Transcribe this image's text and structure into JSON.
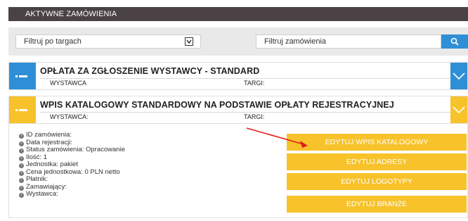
{
  "page_title": "AKTYWNE ZAMÓWIENIA",
  "filters": {
    "select_value": "Filtruj po targach",
    "search_placeholder": "Filtruj zamówienia"
  },
  "orders": [
    {
      "title": "OPŁATA ZA ZGŁOSZENIE WYSTAWCY - STANDARD",
      "exhibitor_label": "WYSTAWCA",
      "fair_label": "TARGI:",
      "color": "#2e8fd6",
      "expanded": false
    },
    {
      "title": "WPIS KATALOGOWY STANDARDOWY NA PODSTAWIE OPŁATY REJESTRACYJNEJ",
      "exhibitor_label": "WYSTAWCA:",
      "fair_label": "TARGI:",
      "color": "#f7c22a",
      "expanded": true,
      "details": [
        "ID zamówienia:",
        "Data rejestracji:",
        "Status zamówienia: Opracowanie",
        "Ilość: 1",
        "Jednostka: pakiet",
        "Cena jednostkowa: 0 PLN netto",
        "Płatnik:",
        "Zamawiający:",
        "Wystawca:"
      ],
      "actions": [
        "EDYTUJ WPIS KATALOGOWY",
        "EDYTUJ ADRESY",
        "EDYTUJ LOGOTYPY",
        "EDYTUJ BRANŻE"
      ]
    }
  ],
  "colors": {
    "header_bg": "#4a4244",
    "accent_blue": "#2e8fd6",
    "accent_yellow": "#f7c22a",
    "annotation_arrow": "#e0201a"
  },
  "icons": [
    "chevron-down-icon",
    "search-icon",
    "dropdown-arrow-icon",
    "order-menu-icon",
    "bullet-icon"
  ]
}
